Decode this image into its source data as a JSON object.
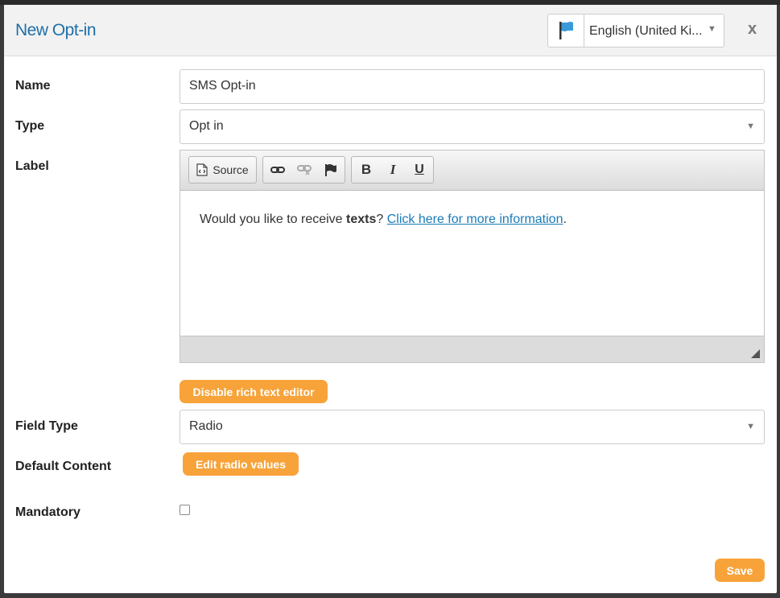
{
  "dialog": {
    "title": "New Opt-in",
    "language": "English (United Ki...",
    "close_label": "x"
  },
  "form": {
    "name": {
      "label": "Name",
      "value": "SMS Opt-in"
    },
    "type": {
      "label": "Type",
      "value": "Opt in"
    },
    "label_field": {
      "label": "Label",
      "toolbar": {
        "source_label": "Source",
        "bold": "B",
        "italic": "I",
        "underline": "U"
      },
      "content": {
        "text_before": "Would you like to receive ",
        "bold_text": "texts",
        "text_mid": "? ",
        "link_text": "Click here for more information",
        "text_after": "."
      }
    },
    "disable_rich_text_button": "Disable rich text editor",
    "field_type": {
      "label": "Field Type",
      "value": "Radio"
    },
    "default_content": {
      "label": "Default Content",
      "button": "Edit radio values"
    },
    "mandatory": {
      "label": "Mandatory",
      "checked": false
    }
  },
  "footer": {
    "save_label": "Save"
  },
  "colors": {
    "accent": "#f7a33a",
    "title": "#1f6fa8",
    "link": "#1a7bb8",
    "flag": "#3a9ad9"
  },
  "icons": [
    "flag-icon",
    "chevron-down-icon",
    "close-icon",
    "source-icon",
    "link-icon",
    "unlink-icon",
    "anchor-flag-icon",
    "resize-icon"
  ]
}
